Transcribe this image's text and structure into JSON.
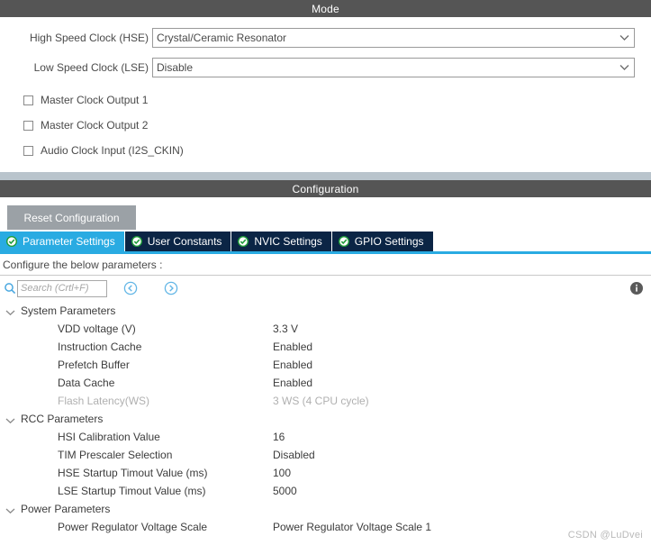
{
  "mode": {
    "header": "Mode",
    "combos": [
      {
        "label": "High Speed Clock (HSE)",
        "value": "Crystal/Ceramic Resonator",
        "icon": "chevron-down-icon"
      },
      {
        "label": "Low Speed Clock (LSE)",
        "value": "Disable",
        "icon": "chevron-down-icon"
      }
    ],
    "checkboxes": [
      {
        "label": "Master Clock Output 1",
        "checked": false
      },
      {
        "label": "Master Clock Output 2",
        "checked": false
      },
      {
        "label": "Audio Clock Input (I2S_CKIN)",
        "checked": false
      }
    ]
  },
  "configuration": {
    "header": "Configuration",
    "reset_label": "Reset Configuration",
    "tabs": [
      {
        "label": "Parameter Settings",
        "active": true,
        "icon": "check-circle-icon"
      },
      {
        "label": "User Constants",
        "active": false,
        "icon": "check-circle-icon"
      },
      {
        "label": "NVIC Settings",
        "active": false,
        "icon": "check-circle-icon"
      },
      {
        "label": "GPIO Settings",
        "active": false,
        "icon": "check-circle-icon"
      }
    ],
    "hint": "Configure the below parameters :",
    "search": {
      "placeholder": "Search (Crtl+F)",
      "value": "",
      "icon": "search-icon",
      "prev_icon": "circle-left-arrow-icon",
      "next_icon": "circle-right-arrow-icon",
      "info_icon": "info-icon"
    },
    "groups": [
      {
        "label": "System Parameters",
        "expanded": true,
        "rows": [
          {
            "name": "VDD voltage (V)",
            "value": "3.3 V",
            "disabled": false
          },
          {
            "name": "Instruction Cache",
            "value": "Enabled",
            "disabled": false
          },
          {
            "name": "Prefetch Buffer",
            "value": "Enabled",
            "disabled": false
          },
          {
            "name": "Data Cache",
            "value": "Enabled",
            "disabled": false
          },
          {
            "name": "Flash Latency(WS)",
            "value": "3 WS (4 CPU cycle)",
            "disabled": true
          }
        ]
      },
      {
        "label": "RCC Parameters",
        "expanded": true,
        "rows": [
          {
            "name": "HSI Calibration Value",
            "value": "16",
            "disabled": false
          },
          {
            "name": "TIM Prescaler Selection",
            "value": "Disabled",
            "disabled": false
          },
          {
            "name": "HSE Startup Timout Value (ms)",
            "value": "100",
            "disabled": false
          },
          {
            "name": "LSE Startup Timout Value (ms)",
            "value": "5000",
            "disabled": false
          }
        ]
      },
      {
        "label": "Power Parameters",
        "expanded": true,
        "rows": [
          {
            "name": "Power Regulator Voltage Scale",
            "value": "Power Regulator Voltage Scale 1",
            "disabled": false
          }
        ]
      }
    ]
  },
  "watermark": "CSDN @LuDvei",
  "colors": {
    "section_bar": "#555555",
    "tab_active": "#29abe2",
    "tab_inactive": "#0b2545",
    "splitter": "#b9c4cc",
    "accent": "#29abe2",
    "check_green": "#1f9d3a"
  }
}
